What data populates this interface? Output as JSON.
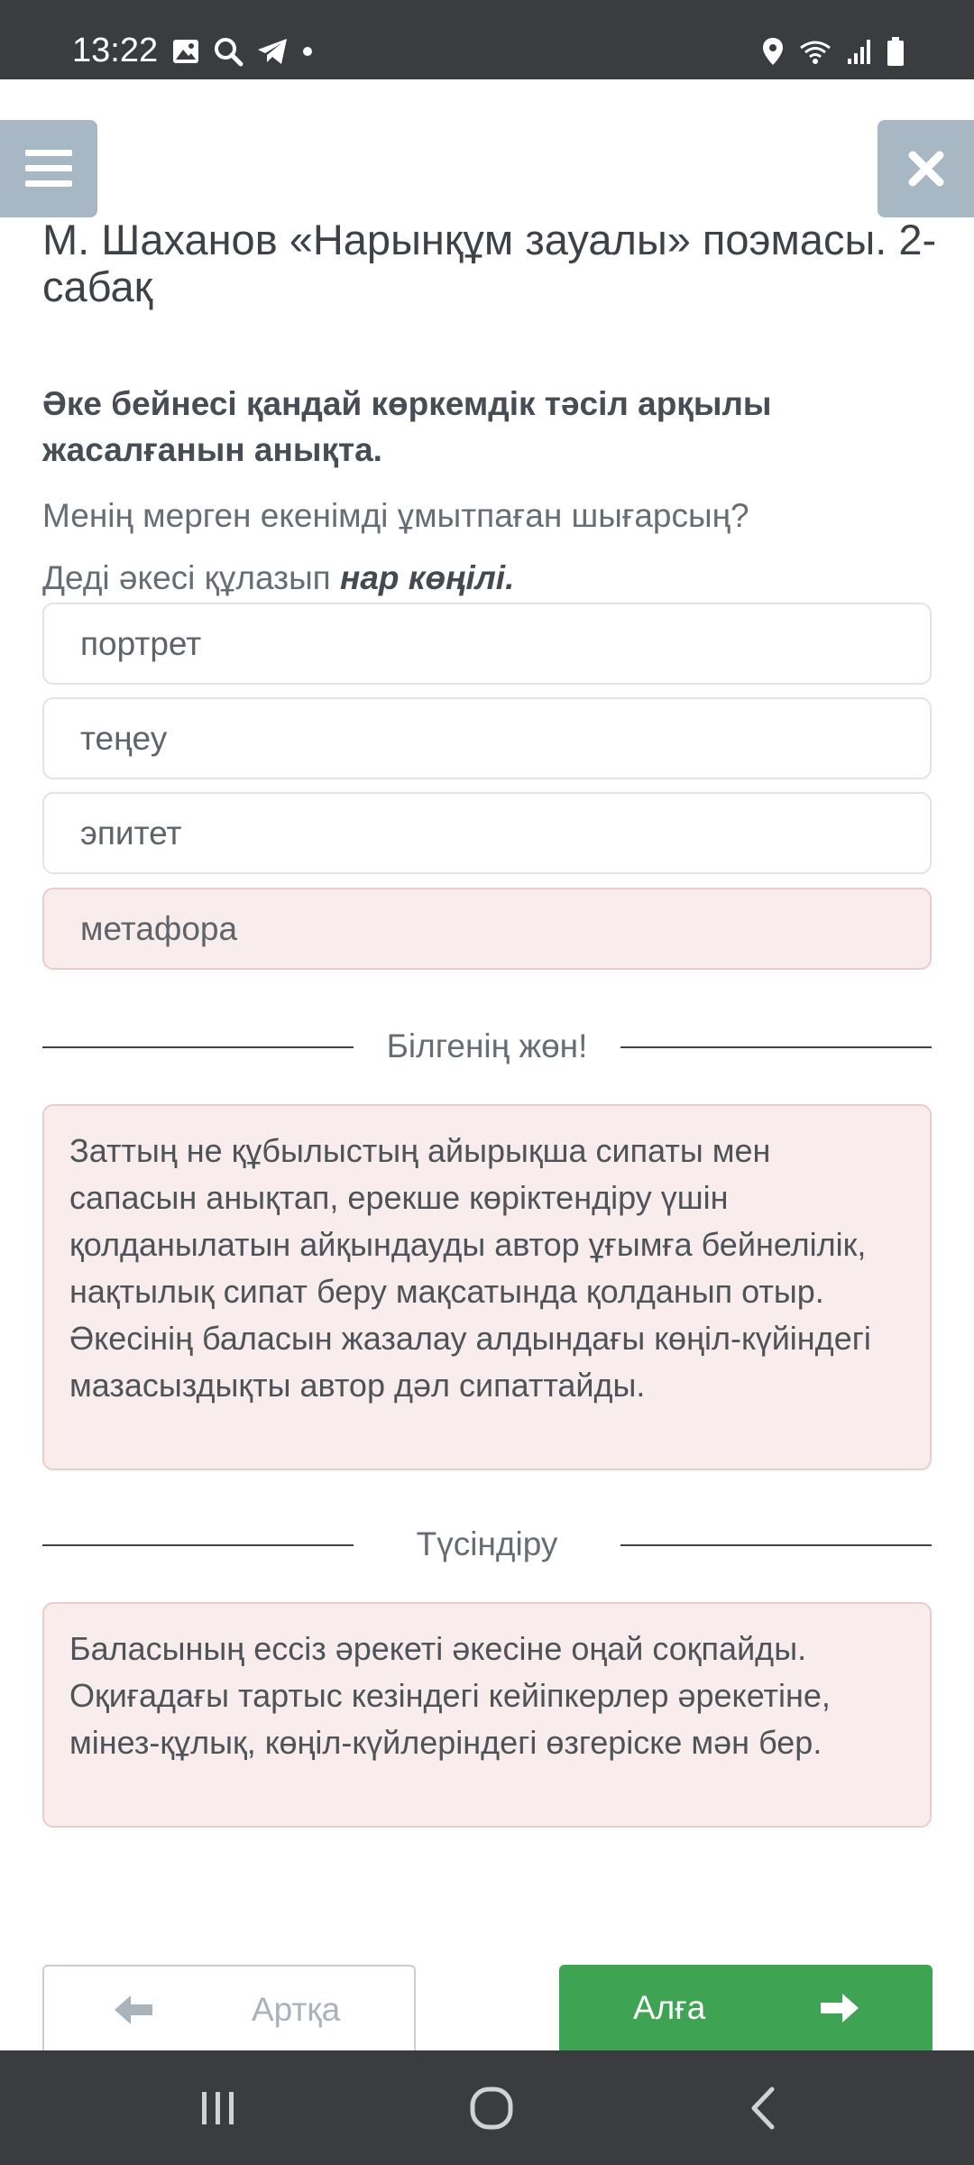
{
  "status_bar": {
    "time": "13:22",
    "icons": [
      "image-icon",
      "search-icon",
      "telegram-icon",
      "dot-icon",
      "location-icon",
      "wifi-icon",
      "signal-icon",
      "battery-icon"
    ]
  },
  "header": {
    "menu_icon": "hamburger-icon",
    "close_icon": "close-icon",
    "title": "М. Шаханов «Нарынқұм зауалы» поэмасы. 2-сабақ"
  },
  "question": {
    "text": "Әке бейнесі қандай көркемдік тәсіл арқылы жасалғанын анықта.",
    "quote_line_1": "Менің мерген екенімді ұмытпаған шығарсың?",
    "quote_line_2_prefix": "Деді әкесі құлазып ",
    "quote_line_2_emphasis": "нар көңілі."
  },
  "options": [
    {
      "label": "портрет",
      "selected": false
    },
    {
      "label": "теңеу",
      "selected": false
    },
    {
      "label": "эпитет",
      "selected": false
    },
    {
      "label": "метафора",
      "selected": true
    }
  ],
  "feedback": {
    "heading": "Білгенің жөн!",
    "text": "Заттың не құбылыстың айырықша сипаты мен сапасын анықтап, ерекше көріктендіру үшін қолданылатын айқындауды автор ұғымға бейнелілік, нақтылық сипат беру мақсатында қолданып отыр. Әкесінің баласын жазалау алдындағы көңіл-күйіндегі мазасыздықты автор дәл сипаттайды."
  },
  "explanation": {
    "heading": "Түсіндіру",
    "text": "Баласының ессіз әрекеті әкесіне оңай соқпайды. Оқиғадағы тартыс кезіндегі кейіпкерлер әрекетіне, мінез-құлық, көңіл-күйлеріндегі өзгеріске мән бер."
  },
  "navigation": {
    "back_label": "Артқа",
    "forward_label": "Алға"
  },
  "colors": {
    "status_bar": "#3a3c40",
    "header_button": "#a7b7c4",
    "selected_option_bg": "#f9ecec",
    "feedback_bg": "#f9ecec",
    "forward_button": "#3ea353"
  }
}
